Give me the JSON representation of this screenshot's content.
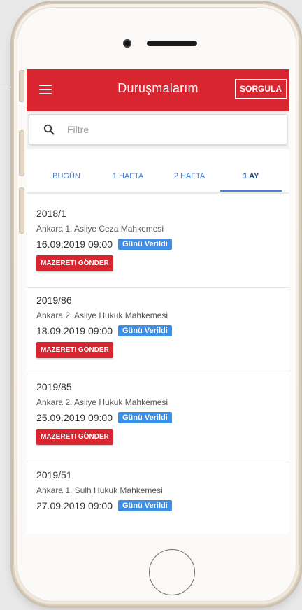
{
  "header": {
    "title": "Duruşmalarım",
    "action_label": "SORGULA"
  },
  "search": {
    "placeholder": "Filtre"
  },
  "tabs": [
    {
      "label": "BUGÜN"
    },
    {
      "label": "1 HAFTA"
    },
    {
      "label": "2 HAFTA"
    },
    {
      "label": "1 AY",
      "active": true
    }
  ],
  "cases": [
    {
      "number": "2018/1",
      "court": "Ankara 1. Asliye Ceza Mahkemesi",
      "datetime": "16.09.2019 09:00",
      "status": "Günü Verildi",
      "action": "MAZERETI GÖNDER"
    },
    {
      "number": "2019/86",
      "court": "Ankara 2. Asliye Hukuk Mahkemesi",
      "datetime": "18.09.2019 09:00",
      "status": "Günü Verildi",
      "action": "MAZERETI GÖNDER"
    },
    {
      "number": "2019/85",
      "court": "Ankara 2. Asliye Hukuk Mahkemesi",
      "datetime": "25.09.2019 09:00",
      "status": "Günü Verildi",
      "action": "MAZERETI GÖNDER"
    },
    {
      "number": "2019/51",
      "court": "Ankara 1. Sulh Hukuk Mahkemesi",
      "datetime": "27.09.2019 09:00",
      "status": "Günü Verildi"
    }
  ],
  "colors": {
    "primary": "#d8252f",
    "accent": "#3d8fe6",
    "tab_active": "#1f4f8f"
  },
  "icons": {
    "menu": "menu-icon",
    "search": "search-icon"
  }
}
